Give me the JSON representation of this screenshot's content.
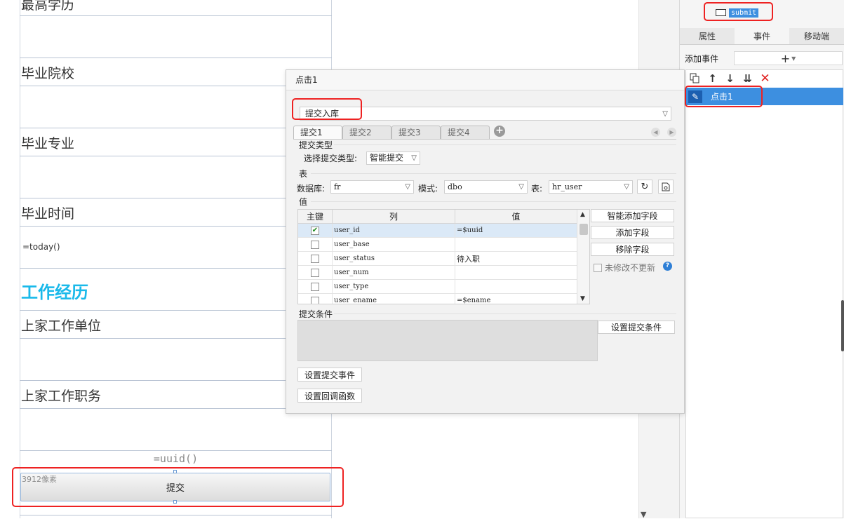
{
  "canvas": {
    "labels": {
      "education": "最高学历",
      "school": "毕业院校",
      "major": "毕业专业",
      "graduate_time": "毕业时间",
      "work_title": "工作经历",
      "last_company": "上家工作单位",
      "last_position": "上家工作职务"
    },
    "today_formula": "=today()",
    "uuid_formula": "=uuid()",
    "width_hint": "3912像素",
    "submit_button": "提交",
    "section_color": "#19b9ea"
  },
  "right_panel": {
    "tree_item_label": "submit",
    "tabs": [
      "属性",
      "事件",
      "移动端"
    ],
    "active_tab": "事件",
    "add_event_label": "添加事件",
    "add_event_symbol": "+",
    "events": [
      "点击1"
    ],
    "toolbar_icons": [
      "copy-icon",
      "arrow-up-icon",
      "arrow-down-icon",
      "move-to-bottom-icon",
      "delete-icon"
    ]
  },
  "dialog": {
    "title": "点击1",
    "submit_type": "提交入库",
    "subtabs": [
      "提交1",
      "提交2",
      "提交3",
      "提交4"
    ],
    "active_subtab": "提交1",
    "section_submit_type": "提交类型",
    "select_type_label": "选择提交类型:",
    "select_type_value": "智能提交",
    "section_table": "表",
    "db_label": "数据库:",
    "db_value": "fr",
    "mode_label": "模式:",
    "mode_value": "dbo",
    "table_label": "表:",
    "table_value": "hr_user",
    "section_values": "值",
    "grid": {
      "headers": [
        "主键",
        "列",
        "值"
      ],
      "rows": [
        {
          "pk": true,
          "column": "user_id",
          "value": "=$uuid"
        },
        {
          "pk": false,
          "column": "user_base",
          "value": ""
        },
        {
          "pk": false,
          "column": "user_status",
          "value": "待入职"
        },
        {
          "pk": false,
          "column": "user_num",
          "value": ""
        },
        {
          "pk": false,
          "column": "user_type",
          "value": ""
        },
        {
          "pk": false,
          "column": "user_ename",
          "value": "=$ename"
        }
      ]
    },
    "btn_smart_add": "智能添加字段",
    "btn_add_field": "添加字段",
    "btn_remove_field": "移除字段",
    "no_update_label": "未修改不更新",
    "help_symbol": "?",
    "section_condition": "提交条件",
    "btn_set_condition": "设置提交条件",
    "btn_set_submit_event": "设置提交事件",
    "btn_set_callback": "设置回调函数"
  }
}
